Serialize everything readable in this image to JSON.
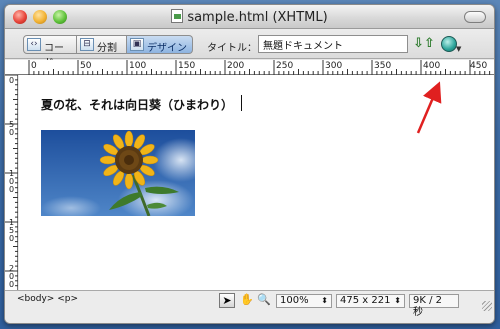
{
  "window": {
    "title": "sample.html (XHTML)"
  },
  "toolbar": {
    "code_label": "コード",
    "split_label": "分割",
    "design_label": "デザイン",
    "title_label": "タイトル：",
    "title_value": "無題ドキュメント"
  },
  "ruler": {
    "h_marks": [
      "0",
      "50",
      "100",
      "150",
      "200",
      "250",
      "300",
      "350",
      "400",
      "450"
    ],
    "v_marks": [
      "0",
      "50",
      "100",
      "150",
      "200"
    ]
  },
  "document": {
    "heading": "夏の花、それは向日葵（ひまわり）",
    "image": "sunflower-photo"
  },
  "status": {
    "tag_path": "<body> <p>",
    "zoom": "100%",
    "size": "475 x 221",
    "weight": "9K / 2 秒"
  },
  "colors": {
    "accent_arrow": "#e02020",
    "design_active": "#8db3e0"
  }
}
